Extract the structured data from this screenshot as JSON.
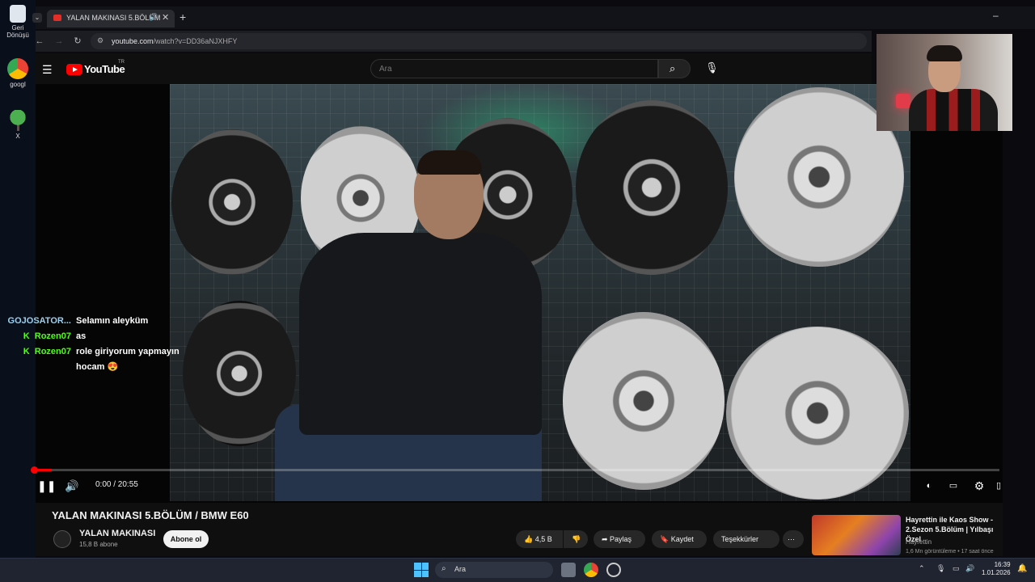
{
  "desktop": {
    "icons": [
      {
        "label": "Geri Dönüşü",
        "icon": "recycle-bin-icon"
      },
      {
        "label": "googl",
        "icon": "chrome-icon"
      },
      {
        "label": "X",
        "icon": "tree-icon"
      }
    ]
  },
  "browser": {
    "tab_title": "YALAN MAKINASI 5.BÖLÜM",
    "url_host": "youtube.com",
    "url_path": "/watch?v=DD36aNJXHFY",
    "new_tab": "+",
    "minimize": "–"
  },
  "youtube": {
    "logo_text": "YouTube",
    "logo_sup": "TR",
    "search_placeholder": "Ara"
  },
  "chat": [
    {
      "user": "GOJOSATOR...",
      "message": "Selamın aleyküm",
      "badge": ""
    },
    {
      "user": "Rozen07",
      "message": "as",
      "badge": "K"
    },
    {
      "user": "Rozen07",
      "message": "role giriyorum yapmayın hocam 😍",
      "badge": "K"
    }
  ],
  "player": {
    "time": "0:00 / 20:55",
    "progress_fraction": 0.02
  },
  "video": {
    "title": "YALAN MAKINASI 5.BÖLÜM / BMW E60",
    "channel": "YALAN MAKINASI",
    "subscribers": "15,8 B abone",
    "subscribe_label": "Abone ol",
    "likes": "4,5 B",
    "share_label": "Paylaş",
    "save_label": "Kaydet",
    "thanks_label": "Teşekkürler",
    "more_label": "⋯"
  },
  "recommended": {
    "title": "Hayrettin ile Kaos Show - 2.Sezon 5.Bölüm | Yılbaşı Özel",
    "channel": "Hayrettin",
    "meta": "1,6 Mn görüntüleme • 17 saat önce"
  },
  "taskbar": {
    "search_label": "Ara",
    "time": "16:39",
    "date": "1.01.2026"
  }
}
